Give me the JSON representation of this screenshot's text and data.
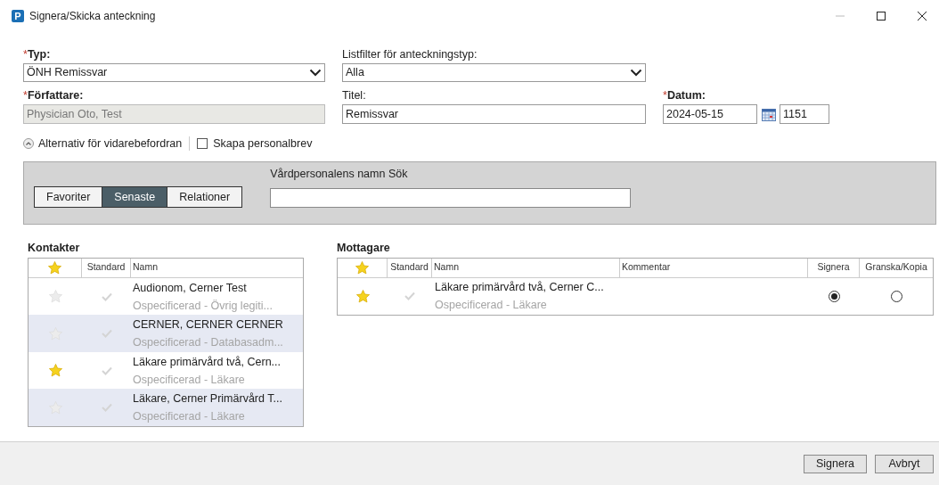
{
  "window": {
    "title": "Signera/Skicka anteckning",
    "app_icon": "P"
  },
  "fields": {
    "typ": {
      "required_mark": "*",
      "label": "Typ:",
      "value": "ÖNH Remissvar"
    },
    "listfilter": {
      "label": "Listfilter för anteckningstyp:",
      "value": "Alla"
    },
    "forfattare": {
      "required_mark": "*",
      "label": "Författare:",
      "value": "Physician Oto, Test",
      "disabled": true
    },
    "titel": {
      "label": "Titel:",
      "value": "Remissvar"
    },
    "datum": {
      "required_mark": "*",
      "label": "Datum:",
      "value": "2024-05-15",
      "time": "1151"
    }
  },
  "options": {
    "forwarding": {
      "label": "Alternativ för vidarebefordran",
      "expanded": true
    },
    "personal_letter": {
      "label": "Skapa personalbrev",
      "checked": false
    }
  },
  "tabs": [
    {
      "label": "Favoriter",
      "selected": false
    },
    {
      "label": "Senaste",
      "selected": true
    },
    {
      "label": "Relationer",
      "selected": false
    }
  ],
  "search": {
    "label": "Vårdpersonalens namn Sök"
  },
  "contacts": {
    "title": "Kontakter",
    "columns": [
      "Standard",
      "Namn"
    ],
    "rows": [
      {
        "name": "Audionom, Cerner Test",
        "role": "Ospecificerad - Övrig legiti...",
        "favorite": false
      },
      {
        "name": "CERNER, CERNER CERNER",
        "role": "Ospecificerad - Databasadm...",
        "favorite": false
      },
      {
        "name": "Läkare primärvård två, Cern...",
        "role": "Ospecificerad - Läkare",
        "favorite": true
      },
      {
        "name": "Läkare, Cerner Primärvård T...",
        "role": "Ospecificerad - Läkare",
        "favorite": false
      }
    ]
  },
  "recipients": {
    "title": "Mottagare",
    "columns": [
      "Standard",
      "Namn",
      "Kommentar",
      "Signera",
      "Granska/Kopia"
    ],
    "rows": [
      {
        "name": "Läkare primärvård två, Cerner C...",
        "role": "Ospecificerad - Läkare",
        "favorite": true,
        "sign": true,
        "review": false
      }
    ]
  },
  "buttons": [
    "Signera",
    "Avbryt"
  ]
}
